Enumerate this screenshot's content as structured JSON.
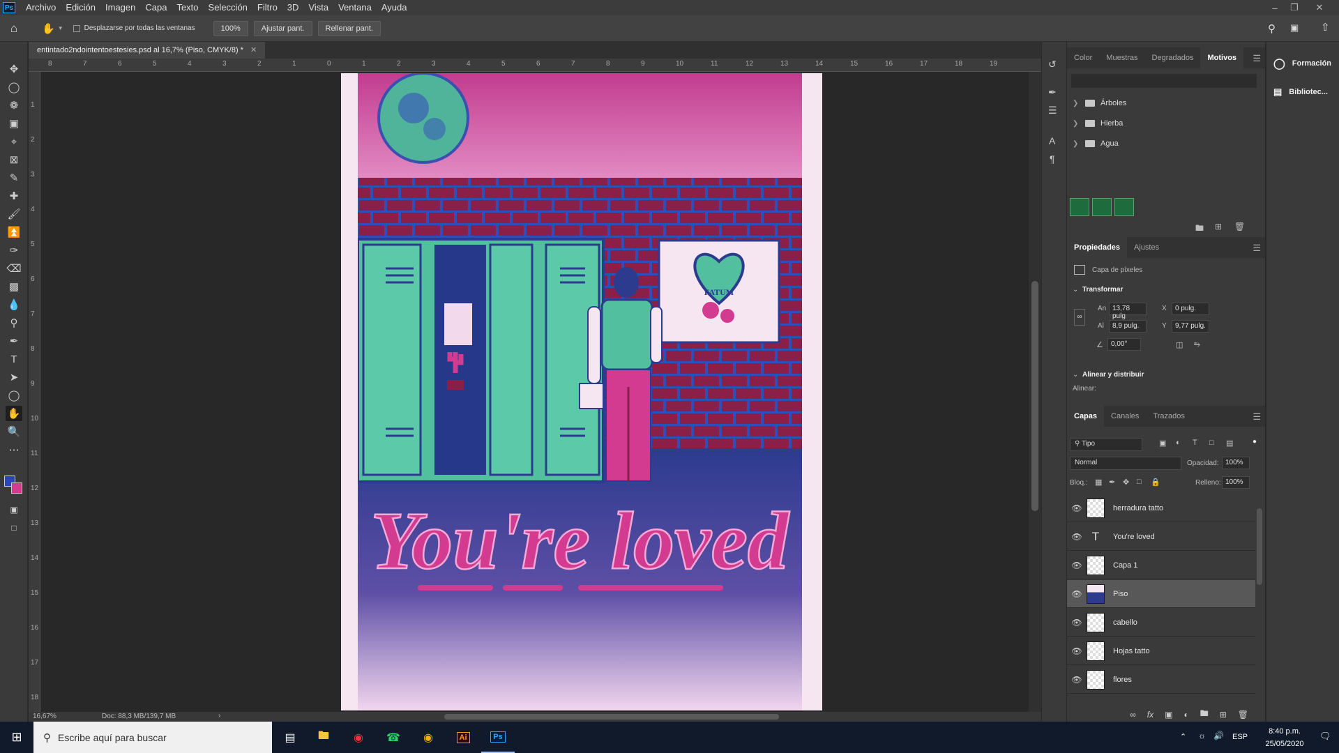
{
  "menubar": {
    "items": [
      "Archivo",
      "Edición",
      "Imagen",
      "Capa",
      "Texto",
      "Selección",
      "Filtro",
      "3D",
      "Vista",
      "Ventana",
      "Ayuda"
    ]
  },
  "options": {
    "scroll_all_label": "Desplazarse por todas las ventanas",
    "zoom_value": "100%",
    "fit_screen_label": "Ajustar pant.",
    "fill_screen_label": "Rellenar pant."
  },
  "document": {
    "tab_title": "entintado2ndointentoestesies.psd al 16,7% (Piso, CMYK/8) *",
    "artwork_text": "You're loved",
    "poster_banner": "FATUM"
  },
  "rulers": {
    "top": [
      "8",
      "7",
      "6",
      "5",
      "4",
      "3",
      "2",
      "1",
      "0",
      "1",
      "2",
      "3",
      "4",
      "5",
      "6",
      "7",
      "8",
      "9",
      "10",
      "11",
      "12",
      "13",
      "14",
      "15",
      "16",
      "17",
      "18",
      "19"
    ],
    "left": [
      "1",
      "2",
      "3",
      "4",
      "5",
      "6",
      "7",
      "8",
      "9",
      "10",
      "11",
      "12",
      "13",
      "14",
      "15",
      "16",
      "17",
      "18"
    ]
  },
  "status": {
    "zoom": "16,67%",
    "doc_size": "Doc: 88,3 MB/139,7 MB"
  },
  "swatches_panel": {
    "tabs": [
      "Color",
      "Muestras",
      "Degradados",
      "Motivos"
    ],
    "active_tab": "Motivos",
    "folders": [
      "Árboles",
      "Hierba",
      "Agua"
    ]
  },
  "properties_panel": {
    "tabs": [
      "Propiedades",
      "Ajustes"
    ],
    "layer_kind": "Capa de píxeles",
    "transform_header": "Transformar",
    "width_label": "An",
    "width": "13,78 pulg",
    "height_label": "Al",
    "height": "8,9 pulg.",
    "x_label": "X",
    "x": "0 pulg.",
    "y_label": "Y",
    "y": "9,77 pulg.",
    "angle": "0,00°",
    "align_header": "Alinear y distribuir",
    "align_label": "Alinear:"
  },
  "layers_panel": {
    "tabs": [
      "Capas",
      "Canales",
      "Trazados"
    ],
    "filter": "Tipo",
    "blend_mode": "Normal",
    "opacity_label": "Opacidad:",
    "opacity": "100%",
    "lock_label": "Bloq.:",
    "fill_label": "Relleno:",
    "fill": "100%",
    "layers": [
      {
        "name": "herradura tatto",
        "type": "pixel"
      },
      {
        "name": "You're loved",
        "type": "text"
      },
      {
        "name": "Capa 1",
        "type": "pixel"
      },
      {
        "name": "Piso",
        "type": "pixel",
        "selected": true
      },
      {
        "name": "cabello",
        "type": "pixel"
      },
      {
        "name": "Hojas tatto",
        "type": "pixel"
      },
      {
        "name": "flores",
        "type": "pixel"
      }
    ]
  },
  "right_panels": {
    "learn_label": "Formación",
    "libraries_label": "Bibliotec..."
  },
  "taskbar": {
    "search_placeholder": "Escribe aquí para buscar",
    "language": "ESP",
    "time": "8:40 p.m.",
    "date": "25/05/2020"
  },
  "colors": {
    "foreground": "#2a46b8",
    "background": "#d23b8f",
    "accent": "#31a8ff"
  }
}
